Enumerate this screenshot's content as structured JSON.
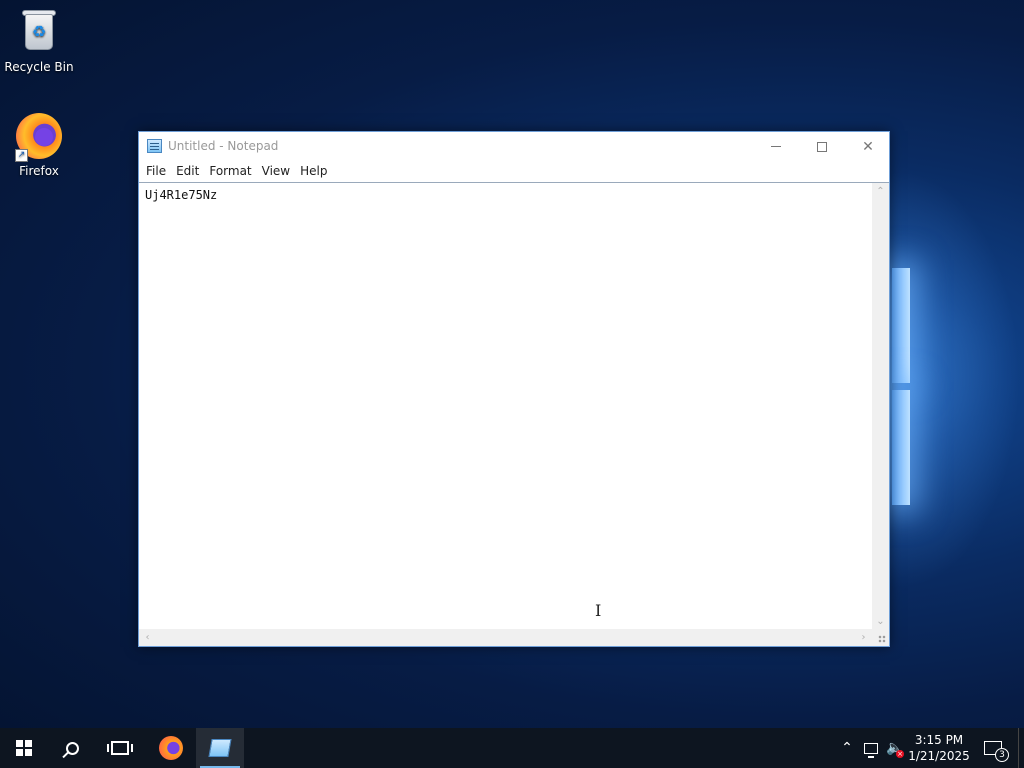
{
  "desktop": {
    "icons": [
      {
        "label": "Recycle Bin"
      },
      {
        "label": "Firefox"
      }
    ]
  },
  "notepad": {
    "title": "Untitled - Notepad",
    "menu": [
      "File",
      "Edit",
      "Format",
      "View",
      "Help"
    ],
    "content": "Uj4R1e75Nz"
  },
  "taskbar": {
    "pinned": [
      "start",
      "search",
      "task-view",
      "firefox",
      "notepad"
    ],
    "active_app": "notepad",
    "clock": {
      "time": "3:15 PM",
      "date": "1/21/2025"
    },
    "notification_count": "3"
  },
  "colors": {
    "desktop_bg": "#0a2b62",
    "taskbar_bg": "#0d1520",
    "window_border": "#6f9fd8",
    "active_indicator": "#76b9ed"
  }
}
